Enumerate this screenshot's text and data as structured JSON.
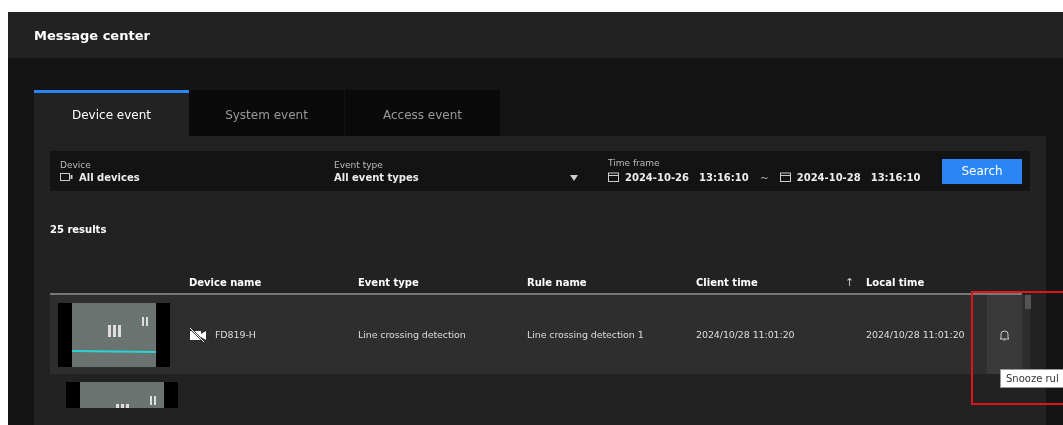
{
  "header": {
    "title": "Message center"
  },
  "tabs": [
    {
      "label": "Device event",
      "selected": true
    },
    {
      "label": "System event",
      "selected": false
    },
    {
      "label": "Access event",
      "selected": false
    }
  ],
  "filters": {
    "device": {
      "label": "Device",
      "value": "All devices"
    },
    "event_type": {
      "label": "Event type",
      "value": "All event types"
    },
    "time_frame": {
      "label": "Time frame",
      "start_date": "2024-10-26",
      "start_time": "13:16:10",
      "separator": "～",
      "end_date": "2024-10-28",
      "end_time": "13:16:10"
    },
    "search_button": "Search"
  },
  "results_count": "25 results",
  "table": {
    "columns": [
      {
        "label": "Device name"
      },
      {
        "label": "Event type"
      },
      {
        "label": "Rule name"
      },
      {
        "label": "Client time",
        "sort_indicator": "↑"
      },
      {
        "label": "Local time"
      }
    ],
    "rows": [
      {
        "selected": true,
        "device_name": "FD819-H",
        "event_type": "Line crossing detection",
        "rule_name": "Line crossing detection 1",
        "client_time": "2024/10/28 11:01:20",
        "local_time": "2024/10/28 11:01:20"
      },
      {
        "selected": false
      }
    ]
  },
  "tooltip": "Snooze rul"
}
